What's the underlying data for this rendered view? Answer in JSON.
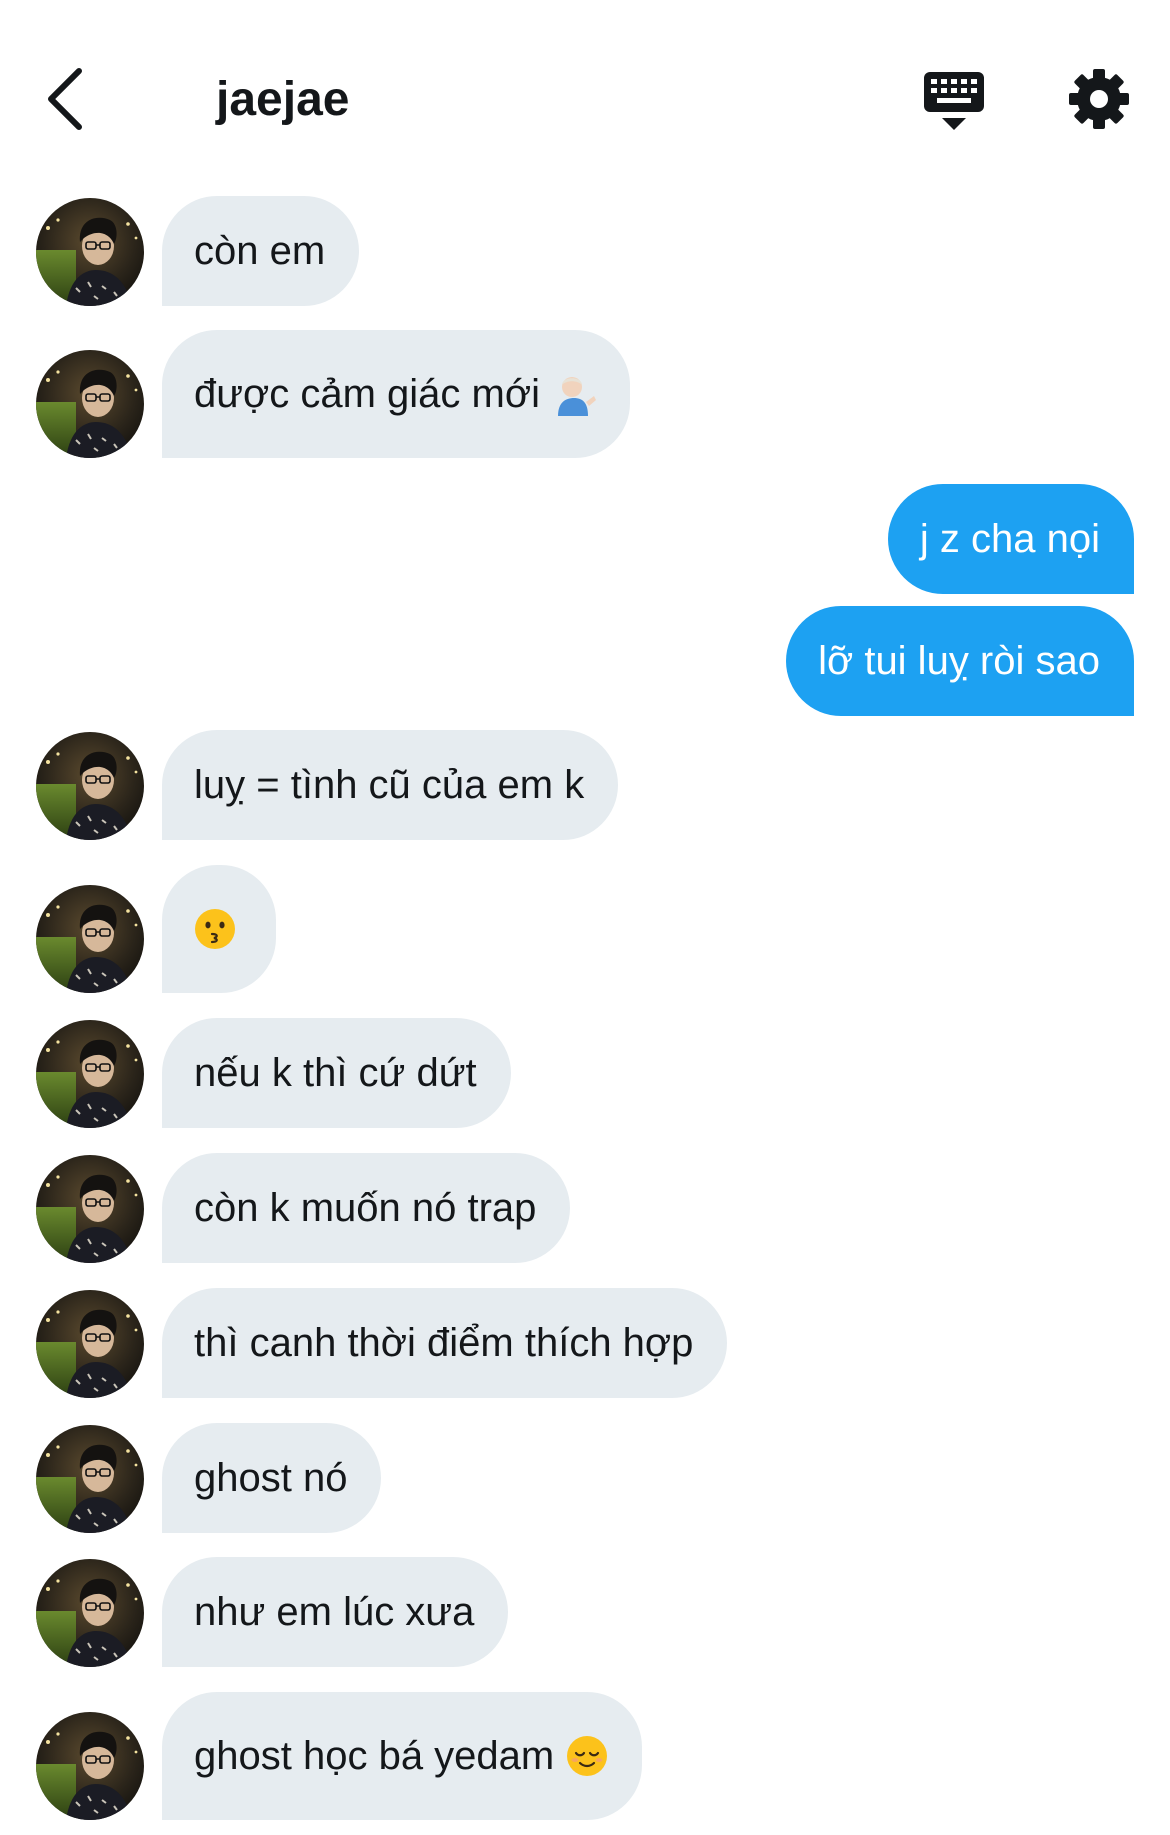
{
  "header": {
    "title": "jaejae"
  },
  "colors": {
    "incoming_bubble": "#e6ecf0",
    "outgoing_bubble": "#1da1f2"
  },
  "icons": {
    "back": "chevron-left-icon",
    "keyboard": "keyboard-icon",
    "settings": "gear-icon"
  },
  "messages": [
    {
      "side": "in",
      "text": "còn em"
    },
    {
      "side": "in",
      "text": "được cảm giác mới",
      "emoji": "person-tipping-hand-emoji"
    },
    {
      "side": "out",
      "text": "j z cha nọi"
    },
    {
      "side": "out",
      "text": "lỡ tui luỵ ròi sao"
    },
    {
      "side": "in",
      "text": "luỵ = tình cũ của em k"
    },
    {
      "side": "in",
      "text": "",
      "emoji": "kissing-face-emoji"
    },
    {
      "side": "in",
      "text": "nếu k thì cứ dứt"
    },
    {
      "side": "in",
      "text": "còn k muốn nó trap"
    },
    {
      "side": "in",
      "text": "thì canh thời điểm thích hợp"
    },
    {
      "side": "in",
      "text": "ghost nó"
    },
    {
      "side": "in",
      "text": "như em lúc xưa"
    },
    {
      "side": "in",
      "text": "ghost học bá yedam",
      "emoji": "relieved-face-emoji"
    }
  ]
}
